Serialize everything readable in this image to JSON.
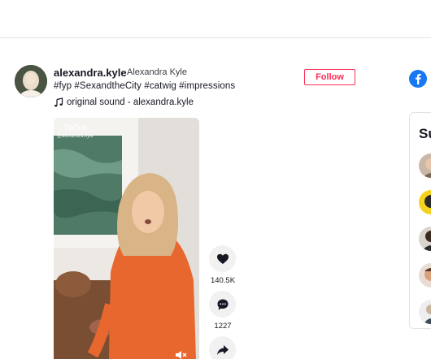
{
  "post": {
    "username": "alexandra.kyle",
    "nickname": "Alexandra Kyle",
    "caption": "#fyp #SexandtheCity #catwig #impressions",
    "sound": "original sound - alexandra.kyle",
    "follow_label": "Follow"
  },
  "video": {
    "watermark_logo": "TikTok",
    "watermark_user": "@alexandra.kyle"
  },
  "actions": {
    "likes": "140.5K",
    "comments": "1227"
  },
  "sidebar": {
    "suggested_title_partial": "Su"
  },
  "colors": {
    "accent": "#fe2c55",
    "facebook": "#1877f2"
  }
}
